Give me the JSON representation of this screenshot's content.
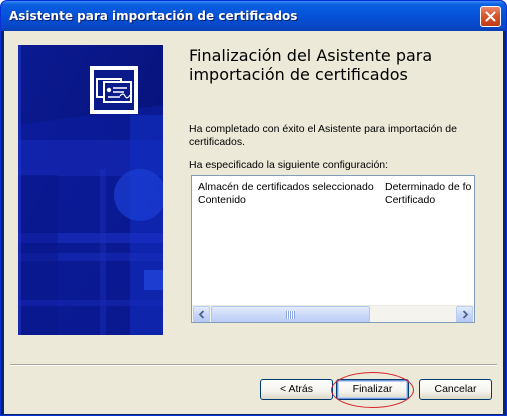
{
  "window": {
    "title": "Asistente para importación de certificados"
  },
  "wizard": {
    "heading": "Finalización del Asistente para importación de certificados",
    "completion_text": "Ha completado con éxito el Asistente para importación de certificados.",
    "config_label": "Ha especificado la siguiente configuración:",
    "settings": [
      {
        "name": "Almacén de certificados seleccionado",
        "value": "Determinado de fo"
      },
      {
        "name": "Contenido",
        "value": "Certificado"
      }
    ]
  },
  "buttons": {
    "back": "< Atrás",
    "finish": "Finalizar",
    "cancel": "Cancelar"
  },
  "colors": {
    "titlebar": "#0552d9",
    "dialog_bg": "#ece9d8",
    "banner_bg": "#0b1a8a",
    "highlight_ring": "#d8202a"
  },
  "icons": [
    "close-icon",
    "certificate-icon",
    "scroll-left-icon",
    "scroll-right-icon"
  ]
}
